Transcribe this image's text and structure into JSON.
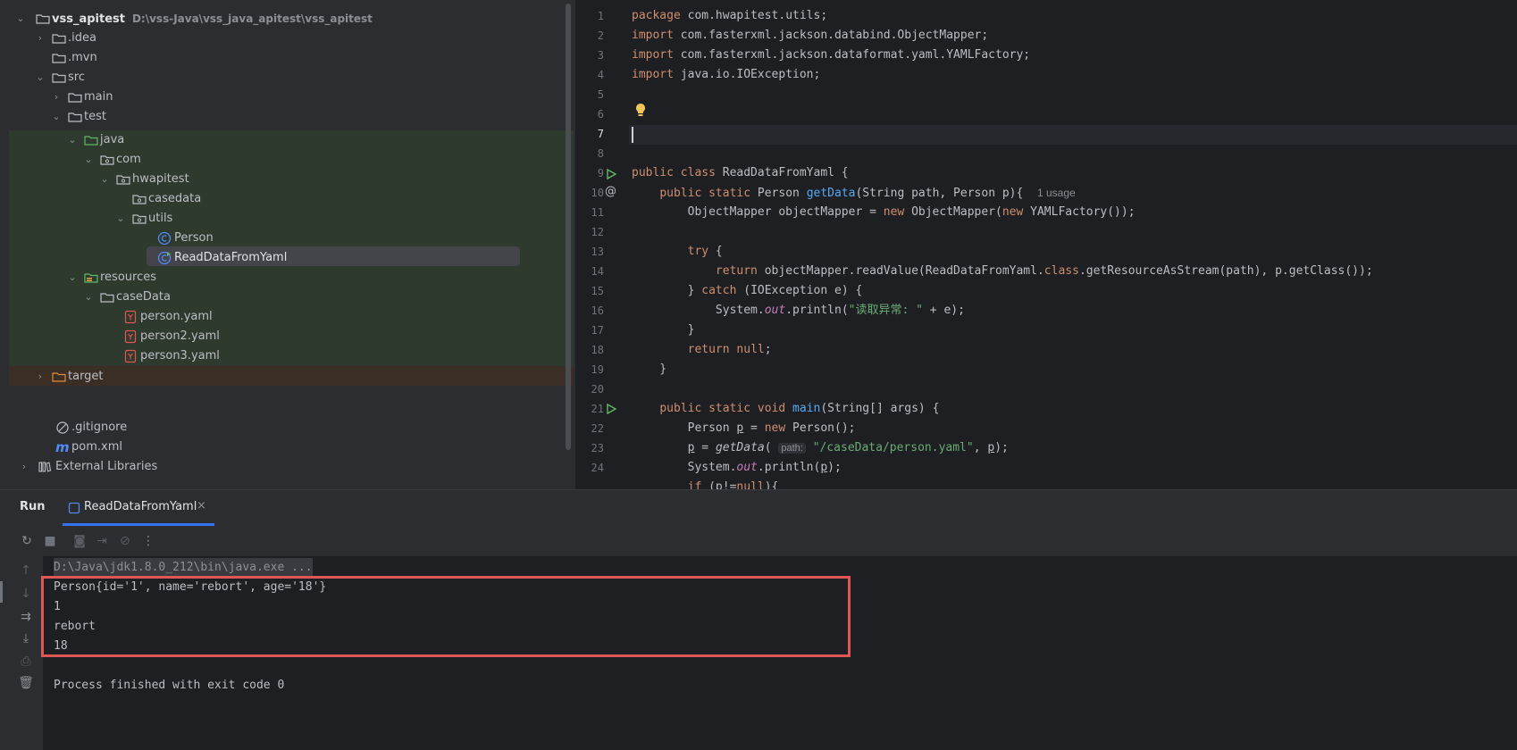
{
  "project_tree": {
    "root": {
      "name": "vss_apitest",
      "path": "D:\\vss-Java\\vss_java_apitest\\vss_apitest"
    },
    "items": [
      {
        "label": ".idea",
        "icon": "folder-icon"
      },
      {
        "label": ".mvn",
        "icon": "folder-icon"
      },
      {
        "label": "src",
        "icon": "folder-icon"
      },
      {
        "label": "main",
        "icon": "folder-icon"
      },
      {
        "label": "test",
        "icon": "folder-icon"
      },
      {
        "label": "java",
        "icon": "source-folder-icon"
      },
      {
        "label": "com",
        "icon": "package-icon"
      },
      {
        "label": "hwapitest",
        "icon": "package-icon"
      },
      {
        "label": "casedata",
        "icon": "package-icon"
      },
      {
        "label": "utils",
        "icon": "package-icon"
      },
      {
        "label": "Person",
        "icon": "class-icon"
      },
      {
        "label": "ReadDataFromYaml",
        "icon": "class-runnable-icon"
      },
      {
        "label": "resources",
        "icon": "resources-folder-icon"
      },
      {
        "label": "caseData",
        "icon": "folder-icon"
      },
      {
        "label": "person.yaml",
        "icon": "yaml-file-icon"
      },
      {
        "label": "person2.yaml",
        "icon": "yaml-file-icon"
      },
      {
        "label": "person3.yaml",
        "icon": "yaml-file-icon"
      },
      {
        "label": "target",
        "icon": "folder-icon"
      },
      {
        "label": ".gitignore",
        "icon": "gitignore-icon"
      },
      {
        "label": "pom.xml",
        "icon": "maven-icon"
      },
      {
        "label": "External Libraries",
        "icon": "library-icon"
      }
    ]
  },
  "editor": {
    "line_numbers": [
      "1",
      "2",
      "3",
      "4",
      "5",
      "6",
      "7",
      "8",
      "9",
      "10",
      "11",
      "12",
      "13",
      "14",
      "15",
      "16",
      "17",
      "18",
      "19",
      "20",
      "21",
      "22",
      "23",
      "24"
    ],
    "usage_hint": "1 usage",
    "inlay_param": "path:",
    "string_read_error": "\"读取异常: \"",
    "string_path": "\"/caseData/person.yaml\""
  },
  "run_panel": {
    "title": "Run",
    "tab_label": "ReadDataFromYaml",
    "command": "D:\\Java\\jdk1.8.0_212\\bin\\java.exe ...",
    "output_lines": [
      "Person{id='1', name='rebort', age='18'}",
      "1",
      "rebort",
      "18"
    ],
    "exit_message": "Process finished with exit code 0"
  },
  "colors": {
    "accent": "#3574f0",
    "highlight_box": "#e05555"
  }
}
